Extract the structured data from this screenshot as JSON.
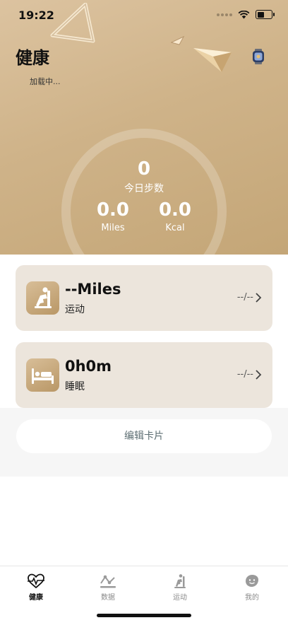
{
  "status_bar": {
    "time": "19:22",
    "battery_level": 0.6
  },
  "header": {
    "title": "健康",
    "subtitle": "加载中..."
  },
  "summary": {
    "steps_value": "0",
    "steps_label": "今日步数",
    "miles_value": "0.0",
    "miles_label": "Miles",
    "kcal_value": "0.0",
    "kcal_label": "Kcal"
  },
  "cards": [
    {
      "value": "--Miles",
      "label": "运动",
      "status": "--/--",
      "icon": "exercise-icon"
    },
    {
      "value": "0h0m",
      "label": "睡眠",
      "status": "--/--",
      "icon": "sleep-icon"
    }
  ],
  "edit_button_label": "编辑卡片",
  "tabs": [
    {
      "label": "健康",
      "icon": "heart-pulse-icon",
      "active": true
    },
    {
      "label": "数据",
      "icon": "data-chart-icon",
      "active": false
    },
    {
      "label": "运动",
      "icon": "exercise-icon",
      "active": false
    },
    {
      "label": "我的",
      "icon": "profile-face-icon",
      "active": false
    }
  ],
  "colors": {
    "hero_gold": "#cfb389",
    "card_background": "#ece5dc",
    "icon_gold": "#c8a97e",
    "active_tab": "#111111",
    "inactive_tab": "#8a8a8a"
  }
}
